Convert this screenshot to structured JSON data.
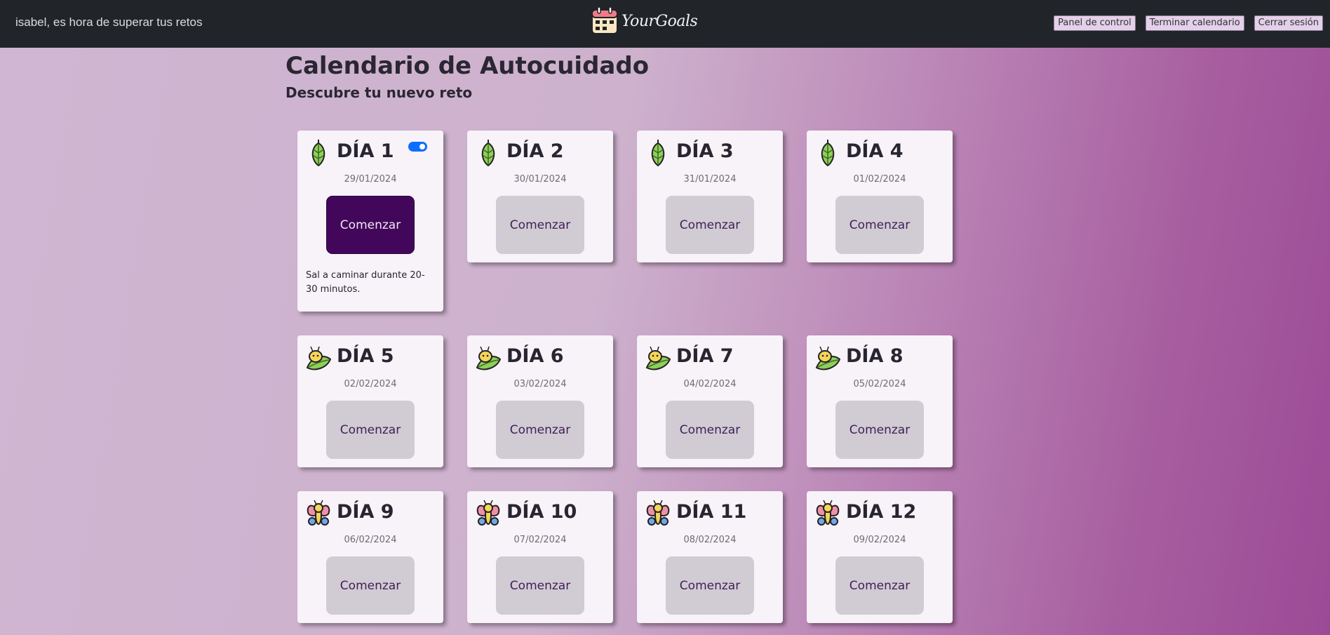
{
  "header": {
    "greeting": "isabel, es hora de superar tus retos",
    "brand": "YourGoals",
    "buttons": [
      "Panel de control",
      "Terminar calendario",
      "Cerrar sesión"
    ]
  },
  "page": {
    "title": "Calendario de Autocuidado",
    "subtitle": "Descubre tu nuevo reto"
  },
  "cards": [
    {
      "title": "DÍA 1",
      "date": "29/01/2024",
      "button": "Comenzar",
      "icon": "cocoon-icon",
      "active": true,
      "toggle_on": true,
      "description": "Sal a caminar durante 20-30 minutos."
    },
    {
      "title": "DÍA 2",
      "date": "30/01/2024",
      "button": "Comenzar",
      "icon": "cocoon-icon"
    },
    {
      "title": "DÍA 3",
      "date": "31/01/2024",
      "button": "Comenzar",
      "icon": "cocoon-icon"
    },
    {
      "title": "DÍA 4",
      "date": "01/02/2024",
      "button": "Comenzar",
      "icon": "cocoon-icon"
    },
    {
      "title": "DÍA 5",
      "date": "02/02/2024",
      "button": "Comenzar",
      "icon": "caterpillar-icon"
    },
    {
      "title": "DÍA 6",
      "date": "03/02/2024",
      "button": "Comenzar",
      "icon": "caterpillar-icon"
    },
    {
      "title": "DÍA 7",
      "date": "04/02/2024",
      "button": "Comenzar",
      "icon": "caterpillar-icon"
    },
    {
      "title": "DÍA 8",
      "date": "05/02/2024",
      "button": "Comenzar",
      "icon": "caterpillar-icon"
    },
    {
      "title": "DÍA 9",
      "date": "06/02/2024",
      "button": "Comenzar",
      "icon": "butterfly-icon"
    },
    {
      "title": "DÍA 10",
      "date": "07/02/2024",
      "button": "Comenzar",
      "icon": "butterfly-icon"
    },
    {
      "title": "DÍA 11",
      "date": "08/02/2024",
      "button": "Comenzar",
      "icon": "butterfly-icon"
    },
    {
      "title": "DÍA 12",
      "date": "09/02/2024",
      "button": "Comenzar",
      "icon": "butterfly-icon"
    }
  ],
  "colors": {
    "navbar": "#212529",
    "active_button": "#42075a",
    "inactive_button": "#d1cbd3",
    "toggle": "#0d6efd",
    "gradient_end": "#9c4a95"
  }
}
